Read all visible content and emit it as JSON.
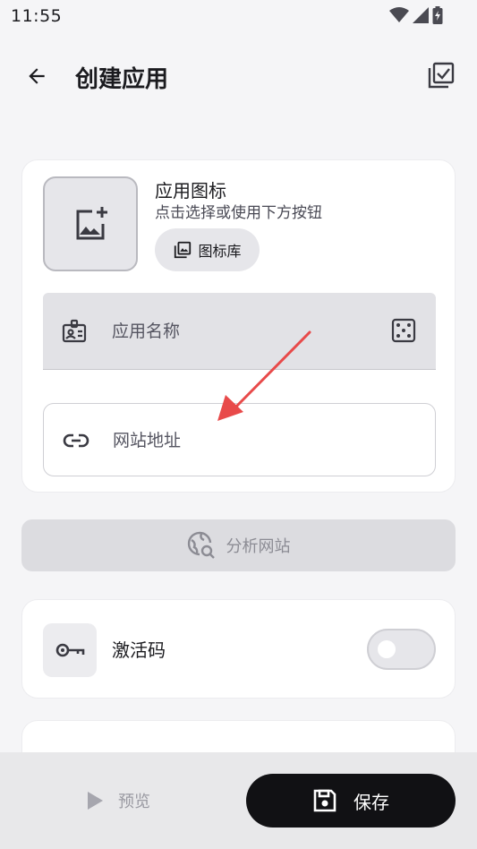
{
  "status_bar": {
    "time": "11:55",
    "icons": [
      "wifi-icon",
      "signal-icon",
      "battery-charging-icon"
    ]
  },
  "app_bar": {
    "title": "创建应用",
    "back_icon": "arrow-back-icon",
    "action_icon": "select-all-icon"
  },
  "icon_section": {
    "title": "应用图标",
    "subtitle": "点击选择或使用下方按钮",
    "preview_icon": "add-photo-icon",
    "gallery_button": {
      "label": "图标库",
      "icon": "photo-library-icon"
    }
  },
  "name_field": {
    "placeholder": "应用名称",
    "leading_icon": "badge-icon",
    "trailing_icon": "dice-icon"
  },
  "url_field": {
    "placeholder": "网站地址",
    "leading_icon": "link-icon"
  },
  "analyze_button": {
    "label": "分析网站",
    "icon": "travel-explore-icon",
    "enabled": false
  },
  "activation": {
    "label": "激活码",
    "icon": "key-icon",
    "enabled": false
  },
  "bottom_bar": {
    "preview": {
      "label": "预览",
      "icon": "play-icon"
    },
    "save": {
      "label": "保存",
      "icon": "save-icon"
    }
  },
  "colors": {
    "accent_dark": "#111114",
    "background": "#f5f5f7",
    "annotation_arrow": "#e84a4a"
  }
}
